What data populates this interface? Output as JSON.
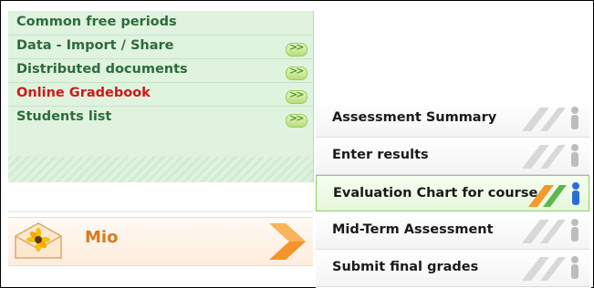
{
  "left_menu": {
    "items": [
      {
        "label": "Common free periods",
        "has_arrow": false,
        "active": false
      },
      {
        "label": "Data - Import / Share",
        "has_arrow": true,
        "active": false
      },
      {
        "label": "Distributed documents",
        "has_arrow": true,
        "active": false
      },
      {
        "label": "Online Gradebook",
        "has_arrow": true,
        "active": true
      },
      {
        "label": "Students list",
        "has_arrow": true,
        "active": false
      }
    ],
    "arrow_glyph": ">>",
    "colors": {
      "background": "#dff3df",
      "text": "#2e6b3c",
      "active_text": "#cc1a1a"
    }
  },
  "mio": {
    "label": "Mio",
    "icon": "envelope-flower-icon",
    "chevron": "orange-chevron-icon",
    "color": "#e07818"
  },
  "submenu": {
    "items": [
      {
        "label": "Assessment Summary",
        "highlight": false
      },
      {
        "label": "Enter results",
        "highlight": false
      },
      {
        "label": "Evaluation Chart for course",
        "highlight": true
      },
      {
        "label": "Mid-Term Assessment",
        "highlight": false
      },
      {
        "label": "Submit final grades",
        "highlight": false
      }
    ],
    "decor_icon": "people-figures-icon",
    "highlight_color": "#8ccf6c"
  }
}
